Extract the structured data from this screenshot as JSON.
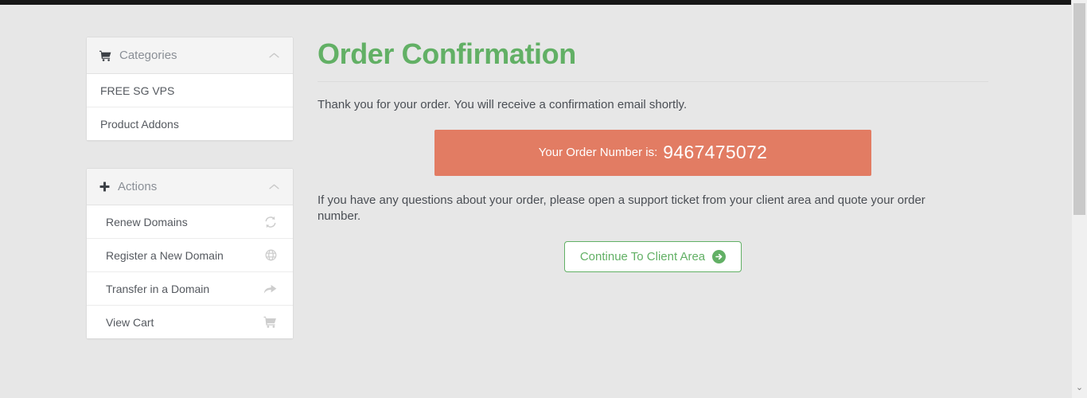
{
  "browser": {
    "scrollbar": {
      "down_arrow_glyph": "⌄"
    }
  },
  "sidebar": {
    "panels": [
      {
        "id": "categories",
        "icon": "shopping-cart-icon",
        "title": "Categories",
        "collapse_glyph": "⌃",
        "items": [
          {
            "label": "FREE SG VPS",
            "icon": ""
          },
          {
            "label": "Product Addons",
            "icon": ""
          }
        ]
      },
      {
        "id": "actions",
        "icon": "plus-icon",
        "title": "Actions",
        "collapse_glyph": "⌃",
        "items": [
          {
            "label": "Renew Domains",
            "icon": "refresh-icon"
          },
          {
            "label": "Register a New Domain",
            "icon": "globe-icon"
          },
          {
            "label": "Transfer in a Domain",
            "icon": "share-arrow-icon"
          },
          {
            "label": "View Cart",
            "icon": "shopping-cart-icon"
          }
        ]
      }
    ]
  },
  "main": {
    "title": "Order Confirmation",
    "intro": "Thank you for your order. You will receive a confirmation email shortly.",
    "order_banner": {
      "label": "Your Order Number is:",
      "number": "9467475072"
    },
    "support_text": "If you have any questions about your order, please open a support ticket from your client area and quote your order number.",
    "continue_button": {
      "label": "Continue To Client Area",
      "icon": "arrow-right-circle-icon"
    }
  },
  "colors": {
    "brand_green": "#62b065",
    "banner_salmon": "#e27c63",
    "page_background": "#e7e7e7",
    "panel_background": "#ffffff",
    "panel_header": "#f4f4f4"
  }
}
